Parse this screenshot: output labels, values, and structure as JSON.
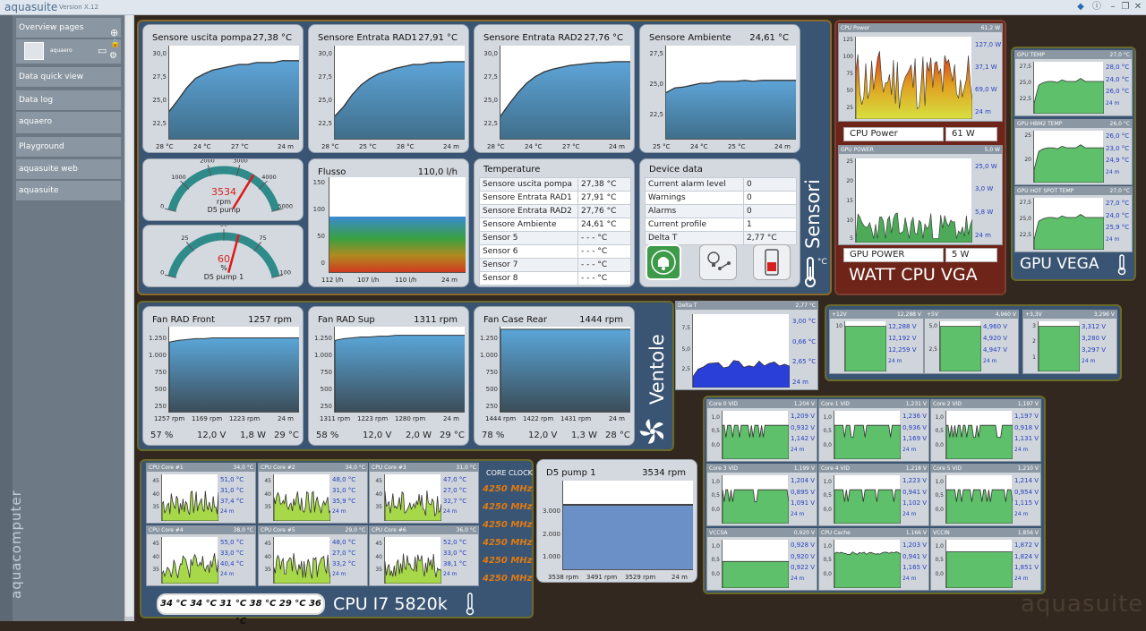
{
  "app": {
    "title": "aquasuite",
    "version": "Version X.12",
    "watermark": "aquasuite",
    "brand_vertical": "aquacomputer"
  },
  "sidebar": {
    "items": [
      {
        "label": "Overview pages"
      },
      {
        "label": "aquaero"
      },
      {
        "label": "Data quick view"
      },
      {
        "label": "Data log"
      },
      {
        "label": "aquaero"
      },
      {
        "label": "Playground"
      },
      {
        "label": "aquasuite web"
      },
      {
        "label": "aquasuite"
      }
    ]
  },
  "sensori": {
    "label": "Sensori",
    "unit": "°C",
    "charts": [
      {
        "title": "Sensore uscita pompa",
        "value": "27,38 °C",
        "y": [
          "30,0",
          "27,5",
          "25,0",
          "22,5"
        ],
        "foot": [
          "28 °C",
          "24 °C",
          "27 °C",
          "24 m"
        ],
        "shape": [
          0.3,
          0.42,
          0.55,
          0.65,
          0.7,
          0.74,
          0.76,
          0.78,
          0.8,
          0.8,
          0.82,
          0.82,
          0.82,
          0.84,
          0.84,
          0.84
        ]
      },
      {
        "title": "Sensore Entrata RAD1",
        "value": "27,91 °C",
        "y": [
          "30,0",
          "27,5",
          "25,0",
          "22,5"
        ],
        "foot": [
          "28 °C",
          "25 °C",
          "28 °C",
          "24 m"
        ],
        "shape": [
          0.25,
          0.35,
          0.48,
          0.58,
          0.65,
          0.7,
          0.73,
          0.76,
          0.78,
          0.8,
          0.8,
          0.82,
          0.82,
          0.83,
          0.83,
          0.83
        ]
      },
      {
        "title": "Sensore Entrata RAD2",
        "value": "27,76 °C",
        "y": [
          "30,0",
          "27,5",
          "25,0",
          "22,5"
        ],
        "foot": [
          "28 °C",
          "24 °C",
          "27 °C",
          "24 m"
        ],
        "shape": [
          0.25,
          0.38,
          0.5,
          0.6,
          0.67,
          0.72,
          0.75,
          0.77,
          0.79,
          0.8,
          0.81,
          0.82,
          0.82,
          0.83,
          0.83,
          0.83
        ]
      },
      {
        "title": "Sensore Ambiente",
        "value": "24,61 °C",
        "y": [
          "27,5",
          "25,0",
          "22,5"
        ],
        "foot": [
          "25 °C",
          "24 °C",
          "25 °C",
          "24 m"
        ],
        "shape": [
          0.5,
          0.55,
          0.56,
          0.58,
          0.6,
          0.6,
          0.62,
          0.62,
          0.62,
          0.63,
          0.62,
          0.63,
          0.63,
          0.63,
          0.63,
          0.63
        ]
      }
    ],
    "gauge1": {
      "value": "3534",
      "unit": "rpm",
      "name": "D5 pump",
      "ticks": [
        "0",
        "1000",
        "2000",
        "3000",
        "4000",
        "5000"
      ],
      "level": 0.707
    },
    "gauge2": {
      "value": "60",
      "unit": "%",
      "name": "D5 pump 1",
      "ticks": [
        "0",
        "25",
        "50",
        "75",
        "100"
      ],
      "level": 0.6
    },
    "flow": {
      "title": "Flusso",
      "value": "110,0 l/h",
      "y": [
        "150",
        "100",
        "50",
        "0"
      ],
      "foot": [
        "112 l/h",
        "107 l/h",
        "110 l/h",
        "24 m"
      ]
    },
    "temps": {
      "title": "Temperature",
      "rows": [
        [
          "Sensore uscita pompa",
          "27,38 °C"
        ],
        [
          "Sensore Entrata RAD1",
          "27,91 °C"
        ],
        [
          "Sensore Entrata RAD2",
          "27,76 °C"
        ],
        [
          "Sensore Ambiente",
          "24,61 °C"
        ],
        [
          "Sensor 5",
          "- - - °C"
        ],
        [
          "Sensor 6",
          "- - - °C"
        ],
        [
          "Sensor 7",
          "- - - °C"
        ],
        [
          "Sensor 8",
          "- - - °C"
        ]
      ]
    },
    "device": {
      "title": "Device data",
      "rows": [
        [
          "Current alarm level",
          "0"
        ],
        [
          "Warnings",
          "0"
        ],
        [
          "Alarms",
          "0"
        ],
        [
          "Current profile",
          "1"
        ],
        [
          "Delta T",
          "2,77 °C"
        ]
      ]
    }
  },
  "ventole": {
    "label": "Ventole",
    "fans": [
      {
        "title": "Fan RAD Front",
        "value": "1257 rpm",
        "y": [
          "1.250",
          "1.000",
          "750",
          "500",
          "250"
        ],
        "foot": [
          "1257 rpm",
          "1169 rpm",
          "1223 rpm",
          "24 m"
        ],
        "stats": [
          "57 %",
          "12,0 V",
          "1,8 W",
          "29 °C"
        ],
        "shape": [
          0.82,
          0.84,
          0.85,
          0.86,
          0.86,
          0.87,
          0.87,
          0.87,
          0.87,
          0.87,
          0.87,
          0.87,
          0.87,
          0.87,
          0.87,
          0.87
        ]
      },
      {
        "title": "Fan RAD Sup",
        "value": "1311 rpm",
        "y": [
          "1.250",
          "1.000",
          "750",
          "500",
          "250"
        ],
        "foot": [
          "1311 rpm",
          "1223 rpm",
          "1280 rpm",
          "24 m"
        ],
        "stats": [
          "58 %",
          "12,0 V",
          "2,0 W",
          "29 °C"
        ],
        "shape": [
          0.84,
          0.86,
          0.87,
          0.88,
          0.88,
          0.89,
          0.89,
          0.9,
          0.9,
          0.9,
          0.9,
          0.9,
          0.9,
          0.9,
          0.9,
          0.9
        ]
      },
      {
        "title": "Fan Case Rear",
        "value": "1444 rpm",
        "y": [
          "1.250",
          "1.000",
          "750",
          "500",
          "250"
        ],
        "foot": [
          "1444 rpm",
          "1422 rpm",
          "1431 rpm",
          "24 m"
        ],
        "stats": [
          "78 %",
          "12,0 V",
          "1,3 W",
          "28 °C"
        ],
        "shape": [
          0.97,
          0.97,
          0.97,
          0.97,
          0.97,
          0.97,
          0.97,
          0.97,
          0.97,
          0.97,
          0.97,
          0.97,
          0.97,
          0.97,
          0.97,
          0.97
        ]
      }
    ]
  },
  "watt": {
    "label": "WATT CPU VGA",
    "cpu": {
      "title": "CPU Power",
      "value": "61,2 W",
      "y": [
        "125",
        "100",
        "75",
        "50",
        "25"
      ],
      "stats": [
        "127,0 W",
        "37,1 W",
        "69,0 W",
        "24 m"
      ],
      "box_label": "CPU Power",
      "box_value": "61 W"
    },
    "gpu": {
      "title": "GPU POWER",
      "value": "5,0 W",
      "y": [
        "25",
        "20",
        "15",
        "10",
        "5"
      ],
      "stats": [
        "25,0 W",
        "3,0 W",
        "5,8 W",
        "24 m"
      ],
      "box_label": "GPU POWER",
      "box_value": "5 W"
    }
  },
  "gpu_vega": {
    "label": "GPU VEGA",
    "charts": [
      {
        "title": "GPU TEMP",
        "value": "27,0 °C",
        "y": [
          "27,5",
          "25,0",
          "22,5"
        ],
        "stats": [
          "28,0 °C",
          "24,0 °C",
          "26,0 °C",
          "24 m"
        ]
      },
      {
        "title": "GPU HBM2 TEMP",
        "value": "26,0 °C",
        "y": [
          "25",
          "20"
        ],
        "stats": [
          "26,0 °C",
          "23,0 °C",
          "24,9 °C",
          "24 m"
        ]
      },
      {
        "title": "GPU HOT SPOT TEMP",
        "value": "27,0 °C",
        "y": [
          "27,5",
          "25,0",
          "22,5"
        ],
        "stats": [
          "27,0 °C",
          "24,0 °C",
          "25,9 °C",
          "24 m"
        ]
      }
    ]
  },
  "delta": {
    "title": "Delta T",
    "value": "2,77 °C",
    "y": [
      "7,5",
      "5,0",
      "2,5"
    ],
    "stats": [
      "3,00 °C",
      "0,66 °C",
      "2,65 °C",
      "24 m"
    ]
  },
  "volts": [
    {
      "title": "+12V",
      "value": "12,288 V",
      "y": [
        "10"
      ],
      "stats": [
        "12,288 V",
        "12,192 V",
        "12,259 V",
        "24 m"
      ]
    },
    {
      "title": "+5V",
      "value": "4,960 V",
      "y": [
        "5,0",
        "2,5"
      ],
      "stats": [
        "4,960 V",
        "4,920 V",
        "4,947 V",
        "24 m"
      ]
    },
    {
      "title": "+3,3V",
      "value": "3,296 V",
      "y": [
        "3",
        "2",
        "1"
      ],
      "stats": [
        "3,312 V",
        "3,280 V",
        "3,297 V",
        "24 m"
      ]
    }
  ],
  "cores": [
    {
      "title": "Core 0 VID",
      "value": "1,204 V",
      "stats": [
        "1,209 V",
        "0,932 V",
        "1,142 V",
        "24 m"
      ]
    },
    {
      "title": "Core 1 VID",
      "value": "1,231 V",
      "stats": [
        "1,236 V",
        "0,936 V",
        "1,169 V",
        "24 m"
      ]
    },
    {
      "title": "Core 2 VID",
      "value": "1,197 V",
      "stats": [
        "1,197 V",
        "0,918 V",
        "1,131 V",
        "24 m"
      ]
    },
    {
      "title": "Core 3 VID",
      "value": "1,199 V",
      "stats": [
        "1,204 V",
        "0,895 V",
        "1,091 V",
        "24 m"
      ]
    },
    {
      "title": "Core 4 VID",
      "value": "1,218 V",
      "stats": [
        "1,223 V",
        "0,941 V",
        "1,102 V",
        "24 m"
      ]
    },
    {
      "title": "Core 5 VID",
      "value": "1,210 V",
      "stats": [
        "1,214 V",
        "0,954 V",
        "1,115 V",
        "24 m"
      ]
    },
    {
      "title": "VCCSA",
      "value": "0,920 V",
      "stats": [
        "0,928 V",
        "0,920 V",
        "0,922 V",
        "24 m"
      ]
    },
    {
      "title": "CPU Cache",
      "value": "1,166 V",
      "stats": [
        "1,203 V",
        "0,941 V",
        "1,165 V",
        "24 m"
      ]
    },
    {
      "title": "VCCIN",
      "value": "1,856 V",
      "stats": [
        "1,872 V",
        "1,824 V",
        "1,851 V",
        "24 m"
      ]
    }
  ],
  "cpu": {
    "label": "CPU I7 5820k",
    "clock_title": "CORE CLOCK",
    "clocks": [
      "4250 MHz",
      "4250 MHz",
      "4250 MHz",
      "4250 MHz",
      "4250 MHz",
      "4250 MHz"
    ],
    "temps_pill": "34 °C   34 °C   31 °C   38 °C   29 °C   36 °C",
    "cores": [
      {
        "title": "CPU Core #1",
        "value": "34,0 °C",
        "stats": [
          "51,0 °C",
          "31,0 °C",
          "37,4 °C",
          "24 m"
        ]
      },
      {
        "title": "CPU Core #2",
        "value": "34,0 °C",
        "stats": [
          "48,0 °C",
          "31,0 °C",
          "35,9 °C",
          "24 m"
        ]
      },
      {
        "title": "CPU Core #3",
        "value": "31,0 °C",
        "stats": [
          "47,0 °C",
          "27,0 °C",
          "32,7 °C",
          "24 m"
        ]
      },
      {
        "title": "CPU Core #4",
        "value": "38,0 °C",
        "stats": [
          "55,0 °C",
          "33,0 °C",
          "40,4 °C",
          "24 m"
        ]
      },
      {
        "title": "CPU Core #5",
        "value": "29,0 °C",
        "stats": [
          "48,0 °C",
          "27,0 °C",
          "33,2 °C",
          "24 m"
        ]
      },
      {
        "title": "CPU Core #6",
        "value": "36,0 °C",
        "stats": [
          "52,0 °C",
          "33,0 °C",
          "38,1 °C",
          "24 m"
        ]
      }
    ]
  },
  "pump": {
    "title": "D5 pump 1",
    "value": "3534 rpm",
    "y": [
      "3.000",
      "2.000",
      "1.000"
    ],
    "foot": [
      "3538 rpm",
      "3491 rpm",
      "3529 rpm",
      "24 m"
    ]
  }
}
